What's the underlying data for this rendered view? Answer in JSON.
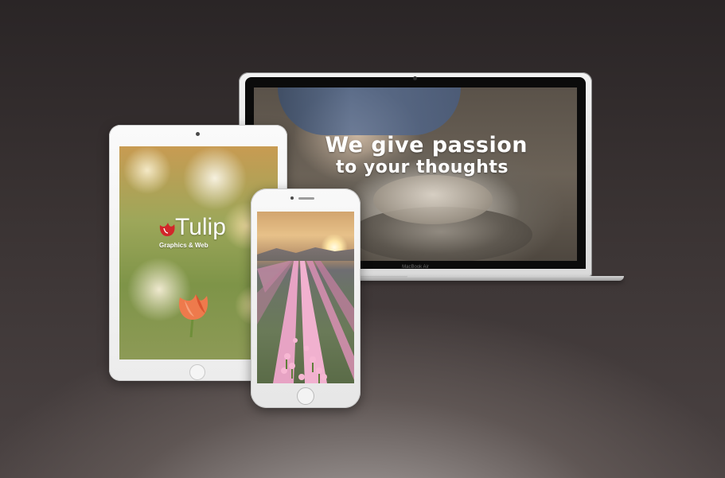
{
  "laptop": {
    "tagline_line1": "We give passion",
    "tagline_line2": "to your thoughts",
    "brand_label": "MacBook Air"
  },
  "tablet": {
    "logo_word": "Tulip",
    "logo_subtitle": "Graphics & Web",
    "logo_icon": "tulip-logo-icon"
  },
  "phone": {
    "scene": "tulip-field-sunset"
  },
  "colors": {
    "background_dark": "#2a2526",
    "background_light": "#bdb9b8",
    "logo_red": "#d2262a",
    "tulip_orange": "#ee7a4c",
    "tulip_pink": "#f3a3c5"
  }
}
